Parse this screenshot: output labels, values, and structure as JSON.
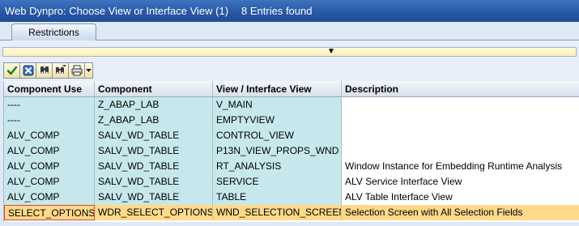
{
  "window": {
    "title": "Web Dynpro: Choose View or Interface View (1)",
    "entries_found": "8 Entries found"
  },
  "tabs": [
    {
      "label": "Restrictions"
    }
  ],
  "restrictions": {
    "toggle_glyph": "▼"
  },
  "toolbar": {
    "buttons": [
      {
        "icon": "checkmark-icon"
      },
      {
        "icon": "cancel-icon"
      },
      {
        "icon": "find-icon"
      },
      {
        "icon": "find-next-icon"
      },
      {
        "icon": "print-icon"
      },
      {
        "icon": "dropdown-arrow-icon"
      }
    ]
  },
  "table": {
    "columns": [
      "Component Use",
      "Component",
      "View / Interface View",
      "Description"
    ],
    "rows": [
      {
        "use": "----",
        "component": "Z_ABAP_LAB",
        "view": "V_MAIN",
        "description": ""
      },
      {
        "use": "----",
        "component": "Z_ABAP_LAB",
        "view": "EMPTYVIEW",
        "description": ""
      },
      {
        "use": "ALV_COMP",
        "component": "SALV_WD_TABLE",
        "view": "CONTROL_VIEW",
        "description": ""
      },
      {
        "use": "ALV_COMP",
        "component": "SALV_WD_TABLE",
        "view": "P13N_VIEW_PROPS_WND",
        "description": ""
      },
      {
        "use": "ALV_COMP",
        "component": "SALV_WD_TABLE",
        "view": "RT_ANALYSIS",
        "description": "Window Instance for Embedding Runtime Analysis"
      },
      {
        "use": "ALV_COMP",
        "component": "SALV_WD_TABLE",
        "view": "SERVICE",
        "description": "ALV Service Interface View"
      },
      {
        "use": "ALV_COMP",
        "component": "SALV_WD_TABLE",
        "view": "TABLE",
        "description": "ALV Table Interface View"
      },
      {
        "use": "SELECT_OPTIONS",
        "component": "WDR_SELECT_OPTIONS",
        "view": "WND_SELECTION_SCREEN",
        "description": "Selection Screen with All Selection Fields"
      }
    ],
    "selected_row_index": 7
  },
  "colors": {
    "title_bar": "#2858a6",
    "key_cell": "#c6e8ec",
    "selected_row": "#ffd98a",
    "restriction_bar": "#fff1b3"
  }
}
